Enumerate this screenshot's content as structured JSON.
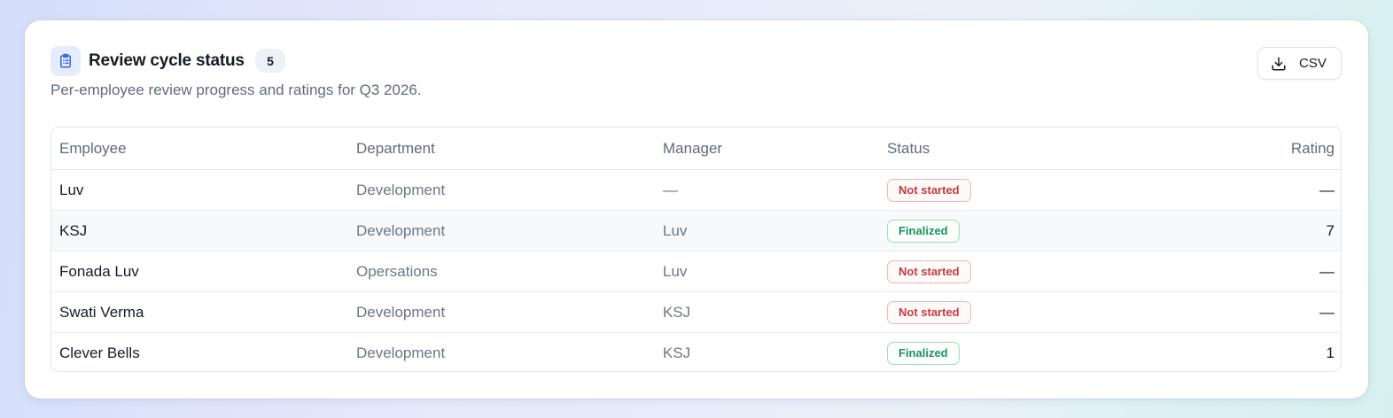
{
  "header": {
    "title": "Review cycle status",
    "count": "5",
    "subtitle": "Per-employee review progress and ratings for Q3 2026.",
    "icon": "clipboard-list-icon"
  },
  "toolbar": {
    "csv_label": "CSV",
    "csv_icon": "download-icon"
  },
  "table": {
    "columns": [
      "Employee",
      "Department",
      "Manager",
      "Status",
      "Rating"
    ],
    "rows": [
      {
        "employee": "Luv",
        "department": "Development",
        "manager": "—",
        "status": "Not started",
        "status_tone": "red",
        "rating": "—"
      },
      {
        "employee": "KSJ",
        "department": "Development",
        "manager": "Luv",
        "status": "Finalized",
        "status_tone": "green",
        "rating": "7"
      },
      {
        "employee": "Fonada Luv",
        "department": "Opersations",
        "manager": "Luv",
        "status": "Not started",
        "status_tone": "red",
        "rating": "—"
      },
      {
        "employee": "Swati Verma",
        "department": "Development",
        "manager": "KSJ",
        "status": "Not started",
        "status_tone": "red",
        "rating": "—"
      },
      {
        "employee": "Clever Bells",
        "department": "Development",
        "manager": "KSJ",
        "status": "Finalized",
        "status_tone": "green",
        "rating": "1"
      }
    ]
  },
  "colors": {
    "accent": "#3b64d8",
    "status_red": "#c8383e",
    "status_green": "#1f9160"
  }
}
